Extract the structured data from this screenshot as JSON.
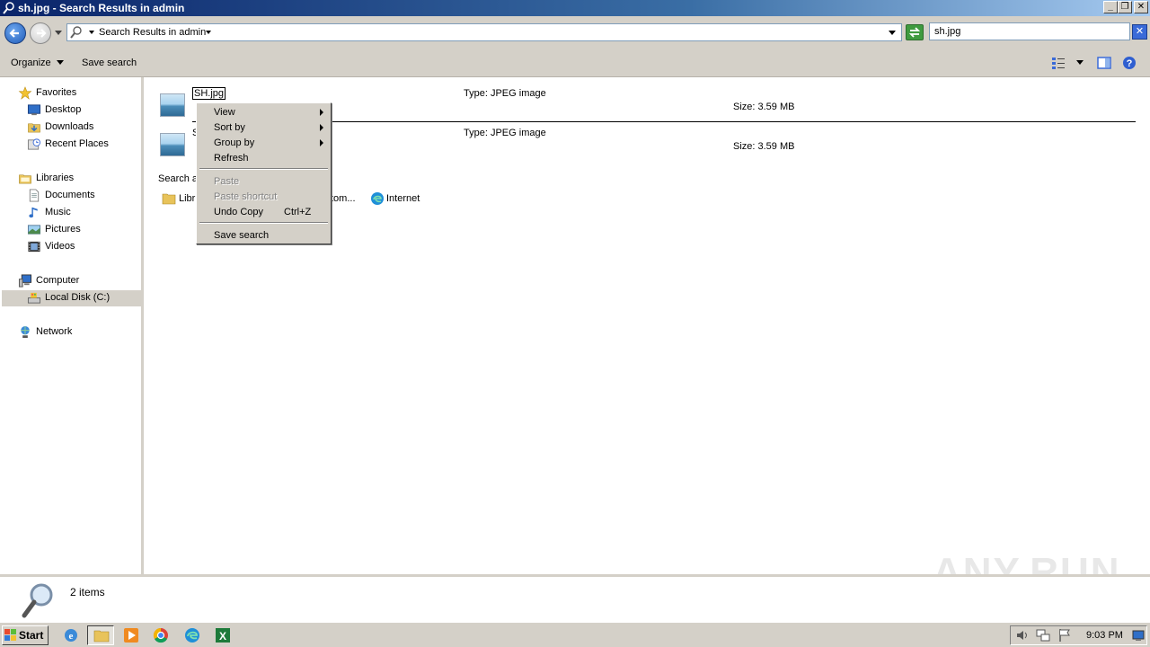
{
  "window": {
    "title": "sh.jpg - Search Results in admin"
  },
  "address": {
    "path": "Search Results in admin",
    "search_value": "sh.jpg"
  },
  "toolbar": {
    "organize": "Organize",
    "save_search": "Save search"
  },
  "nav": {
    "favorites": "Favorites",
    "desktop": "Desktop",
    "downloads": "Downloads",
    "recent_places": "Recent Places",
    "libraries": "Libraries",
    "documents": "Documents",
    "music": "Music",
    "pictures": "Pictures",
    "videos": "Videos",
    "computer": "Computer",
    "local_disk": "Local Disk (C:)",
    "network": "Network"
  },
  "files": [
    {
      "name": "SH.jpg",
      "type": "Type: JPEG image",
      "size": "Size: 3.59 MB"
    },
    {
      "name": "S",
      "type": "Type: JPEG image",
      "size": "Size: 3.59 MB"
    }
  ],
  "search_again": {
    "label": "Search a",
    "libraries": "Libr",
    "custom": "tom...",
    "internet": "Internet"
  },
  "context_menu": {
    "view": "View",
    "sort_by": "Sort by",
    "group_by": "Group by",
    "refresh": "Refresh",
    "paste": "Paste",
    "paste_shortcut": "Paste shortcut",
    "undo_copy": "Undo Copy",
    "undo_shortcut": "Ctrl+Z",
    "save_search": "Save search"
  },
  "details": {
    "count": "2 items"
  },
  "watermark": "ANY.RUN",
  "taskbar": {
    "start": "Start",
    "clock": "9:03 PM"
  }
}
